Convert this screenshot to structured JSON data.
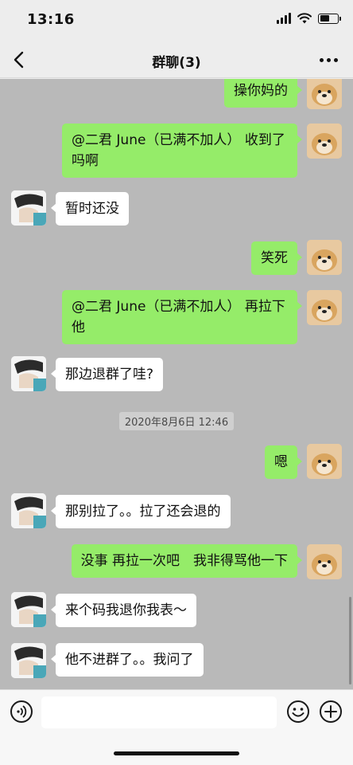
{
  "status_bar": {
    "time": "13:16"
  },
  "header": {
    "title": "群聊(3)"
  },
  "messages": [
    {
      "side": "self",
      "text": "操你妈的"
    },
    {
      "side": "self",
      "text": "@二君 June（已满不加人） 收到了吗啊"
    },
    {
      "side": "other",
      "text": "暂时还没"
    },
    {
      "side": "self",
      "text": "笑死"
    },
    {
      "side": "self",
      "text": "@二君 June（已满不加人） 再拉下他"
    },
    {
      "side": "other",
      "text": "那边退群了哇?"
    },
    {
      "side": "self",
      "text": "嗯"
    },
    {
      "side": "other",
      "text": "那别拉了。。拉了还会退的"
    },
    {
      "side": "self",
      "text": "没事 再拉一次吧　我非得骂他一下"
    },
    {
      "side": "other",
      "text": "来个码我退你我表～"
    },
    {
      "side": "other",
      "text": "他不进群了。。我问了"
    }
  ],
  "timestamp": "2020年8月6日 12:46",
  "icons": {
    "back": "chevron-left-icon",
    "more": "more-dots-icon",
    "voice": "voice-icon",
    "emoji": "emoji-icon",
    "plus": "plus-icon"
  },
  "colors": {
    "self_bubble": "#95ec69",
    "other_bubble": "#ffffff",
    "chat_background": "#b9b9b9",
    "bar_background": "#ededed"
  }
}
